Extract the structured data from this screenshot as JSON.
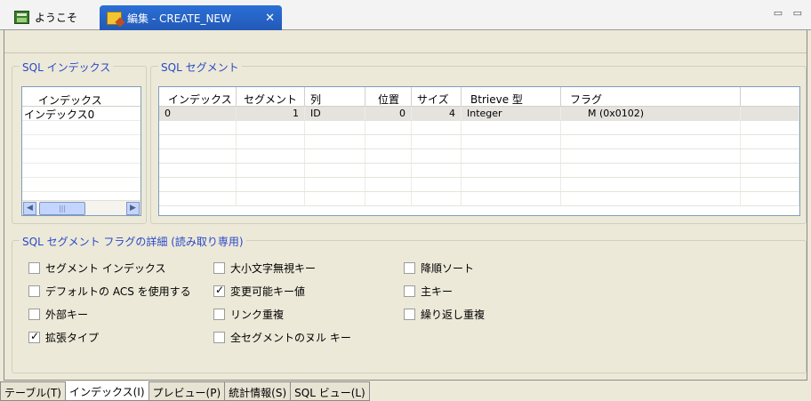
{
  "tabs": {
    "welcome_label": "ようこそ",
    "editor_label": "編集 - CREATE_NEW",
    "close_glyph": "✕",
    "window_controls": "▭ ▭"
  },
  "index_group": {
    "legend": "SQL インデックス",
    "header": "インデックス",
    "items": [
      "インデックス0"
    ]
  },
  "segment_group": {
    "legend": "SQL セグメント",
    "columns": [
      "インデックス",
      "セグメント",
      "列",
      "位置",
      "サイズ",
      "Btrieve 型",
      "フラグ"
    ],
    "rows": [
      {
        "index": "0",
        "segment": "1",
        "column": "ID",
        "position": "0",
        "size": "4",
        "type": "Integer",
        "flags": "M  (0x0102)"
      }
    ]
  },
  "flags_group": {
    "legend": "SQL セグメント フラグの詳細 (読み取り専用)",
    "items": [
      {
        "label": "セグメント インデックス",
        "checked": false
      },
      {
        "label": "デフォルトの ACS を使用する",
        "checked": false
      },
      {
        "label": "外部キー",
        "checked": false
      },
      {
        "label": "拡張タイプ",
        "checked": true
      },
      {
        "label": "大小文字無視キー",
        "checked": false
      },
      {
        "label": "変更可能キー値",
        "checked": true
      },
      {
        "label": "リンク重複",
        "checked": false
      },
      {
        "label": "全セグメントのヌル キー",
        "checked": false
      },
      {
        "label": "降順ソート",
        "checked": false
      },
      {
        "label": "主キー",
        "checked": false
      },
      {
        "label": "繰り返し重複",
        "checked": false
      }
    ]
  },
  "bottom_tabs": [
    {
      "label": "テーブル(T)",
      "active": false
    },
    {
      "label": "インデックス(I)",
      "active": true
    },
    {
      "label": "プレビュー(P)",
      "active": false
    },
    {
      "label": "統計情報(S)",
      "active": false
    },
    {
      "label": "SQL ビュー(L)",
      "active": false
    }
  ],
  "colors": {
    "active_tab": "#2a6fd6",
    "group_legend": "#2a48c8",
    "panel_bg": "#ece9d8"
  }
}
